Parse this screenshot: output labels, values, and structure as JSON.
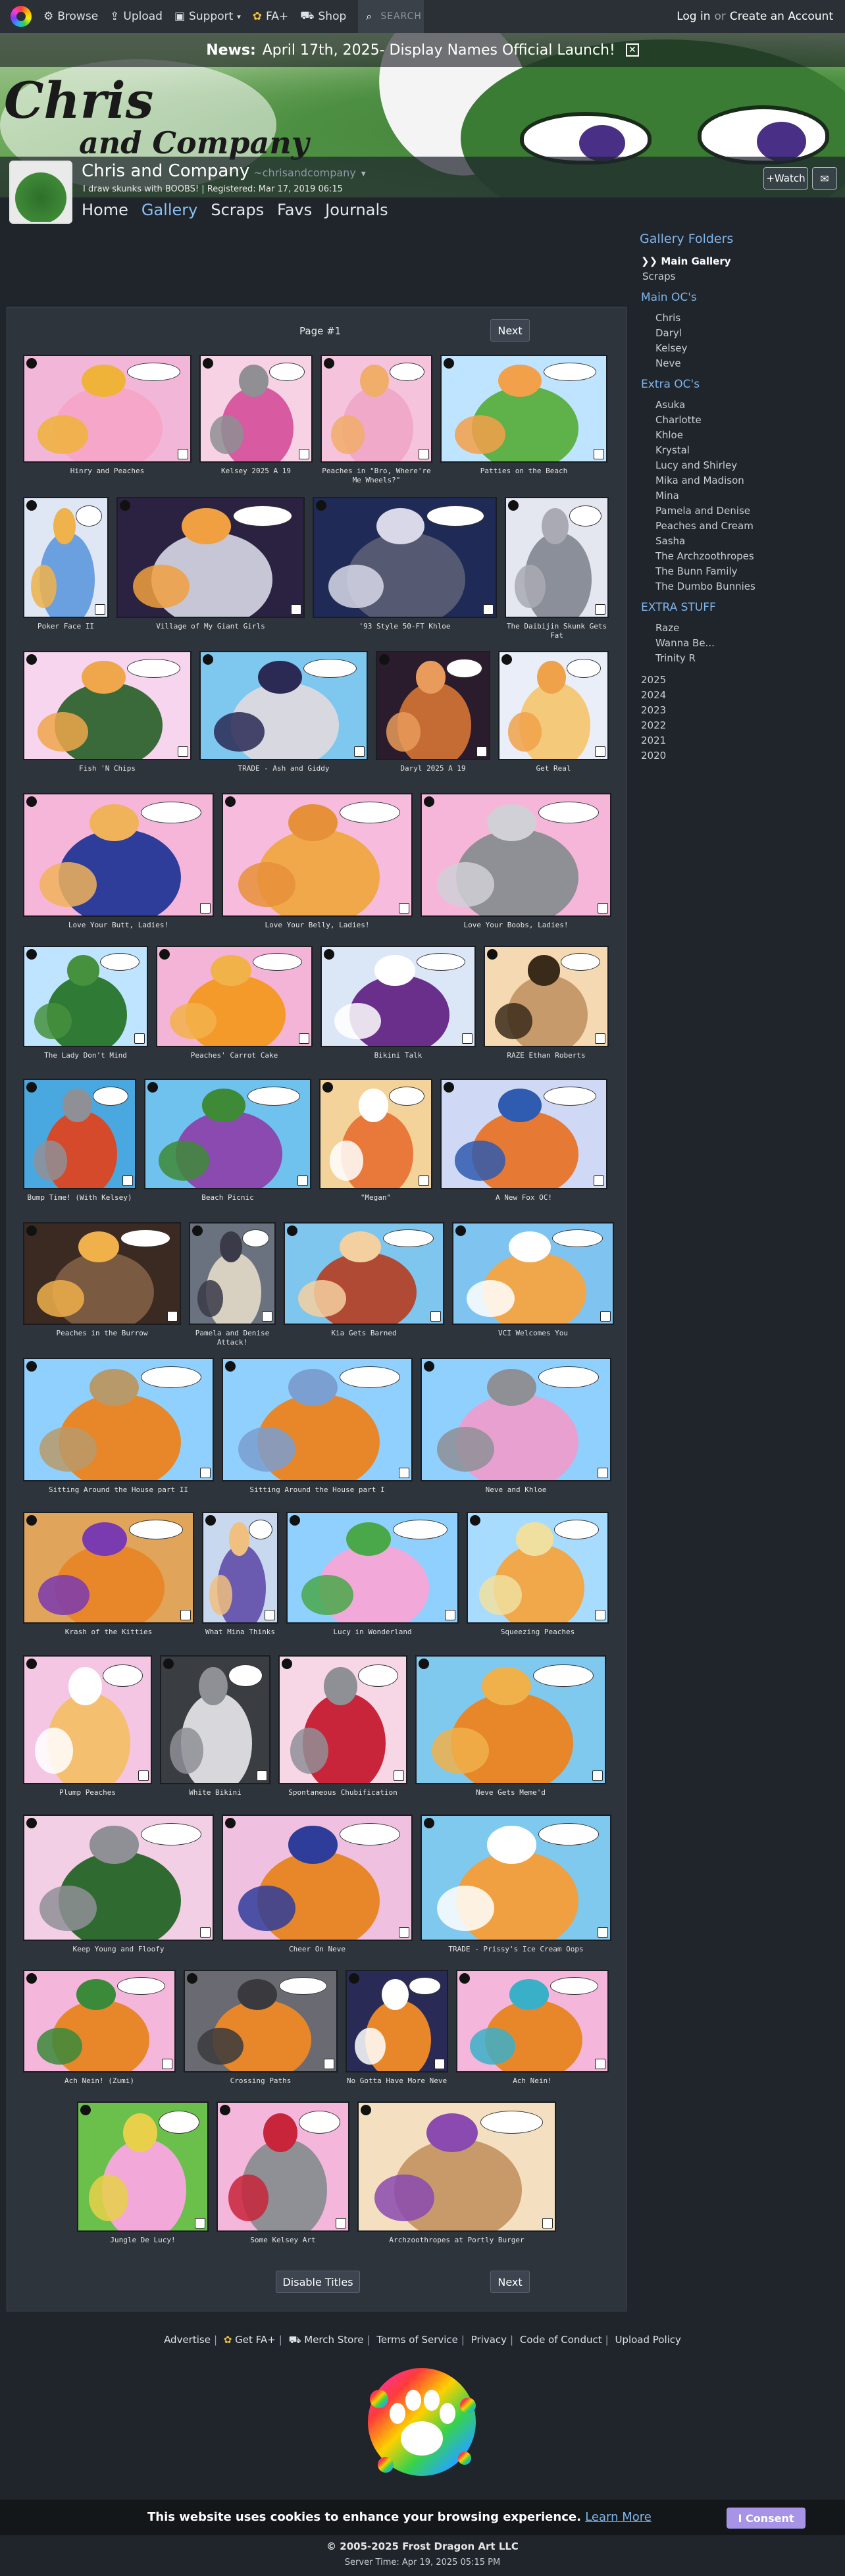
{
  "nav": {
    "browse": "Browse",
    "upload": "Upload",
    "support": "Support",
    "fa_plus": "FA+",
    "shop": "Shop",
    "search_placeholder": "SEARCH",
    "login": "Log in",
    "or": "or",
    "create": "Create an Account"
  },
  "news": {
    "label": "News:",
    "text": "April 17th, 2025- Display Names Official Launch!"
  },
  "banner": {
    "line1": "Chris",
    "line2": "and Company"
  },
  "user": {
    "display_name": "Chris and Company",
    "username": "~chrisandcompany",
    "tagline": "I draw skunks with BOOBS!",
    "registered": "Registered: Mar 17, 2019 06:15",
    "watch": "+Watch"
  },
  "tabs": [
    "Home",
    "Gallery",
    "Scraps",
    "Favs",
    "Journals"
  ],
  "sidebar": {
    "folders_title": "Gallery Folders",
    "main_gallery": "Main Gallery",
    "scraps": "Scraps",
    "main_ocs_title": "Main OC's",
    "main_ocs": [
      "Chris",
      "Daryl",
      "Kelsey",
      "Neve"
    ],
    "extra_ocs_title": "Extra OC's",
    "extra_ocs": [
      "Asuka",
      "Charlotte",
      "Khloe",
      "Krystal",
      "Lucy and Shirley",
      "Mika and Madison",
      "Mina",
      "Pamela and Denise",
      "Peaches and Cream",
      "Sasha",
      "The Archzoothropes",
      "The Bunn Family",
      "The Dumbo Bunnies"
    ],
    "extra_stuff_title": "EXTRA STUFF",
    "extra_stuff": [
      "Raze",
      "Wanna Be...",
      "Trinity R"
    ],
    "years": [
      "2025",
      "2024",
      "2023",
      "2022",
      "2021",
      "2020"
    ]
  },
  "gallery": {
    "page_label": "Page #1",
    "next": "Next",
    "disable_titles": "Disable Titles",
    "items": [
      {
        "title": "Hinry and Peaches",
        "c1": "#f2b6d8",
        "c2": "#f6a6c8",
        "c3": "#f0b33a"
      },
      {
        "title": "Kelsey 2025 A 19",
        "c1": "#f7d2e4",
        "c2": "#d85aa0",
        "c3": "#8f8f94"
      },
      {
        "title": "Peaches in \"Bro, Where're Me Wheels?\"",
        "c1": "#f6c3dc",
        "c2": "#f0a9c9",
        "c3": "#f1ad6a"
      },
      {
        "title": "Patties on the Beach",
        "c1": "#bfe4ff",
        "c2": "#5fb14a",
        "c3": "#f3a04a"
      },
      {
        "title": "Poker Face II",
        "c1": "#dfe7f5",
        "c2": "#6aa0e0",
        "c3": "#f0b24a"
      },
      {
        "title": "Village of My Giant Girls",
        "c1": "#2b2140",
        "c2": "#c6c6d6",
        "c3": "#f0a040"
      },
      {
        "title": "'93 Style 50-FT Khloe",
        "c1": "#1f2b56",
        "c2": "#555a72",
        "c3": "#d8d8e8"
      },
      {
        "title": "The Daibijin Skunk Gets Fat",
        "c1": "#e5e7f0",
        "c2": "#8b8f9a",
        "c3": "#a9aab4"
      },
      {
        "title": "Fish 'N Chips",
        "c1": "#f7d5ee",
        "c2": "#3b6a3a",
        "c3": "#f0a64a"
      },
      {
        "title": "TRADE - Ash and Giddy",
        "c1": "#7ec8f0",
        "c2": "#d8d8e0",
        "c3": "#2a2a55"
      },
      {
        "title": "Daryl 2025 A 19",
        "c1": "#2a1c2c",
        "c2": "#c56c34",
        "c3": "#e89b5a"
      },
      {
        "title": "Get Real",
        "c1": "#e9eef8",
        "c2": "#f4ca7a",
        "c3": "#f0a24a"
      },
      {
        "title": "Love Your Butt, Ladies!",
        "c1": "#f6b6da",
        "c2": "#2f3d9a",
        "c3": "#f0b35a"
      },
      {
        "title": "Love Your Belly, Ladies!",
        "c1": "#f7bbde",
        "c2": "#f0a84a",
        "c3": "#e7903a"
      },
      {
        "title": "Love Your Boobs, Ladies!",
        "c1": "#f6b6da",
        "c2": "#8f8f96",
        "c3": "#d0d0d6"
      },
      {
        "title": "The Lady Don't Mind",
        "c1": "#bfe4ff",
        "c2": "#2f7a34",
        "c3": "#45913d"
      },
      {
        "title": "Peaches' Carrot Cake",
        "c1": "#f4b4d8",
        "c2": "#f49a2a",
        "c3": "#f2b24a"
      },
      {
        "title": "Bikini Talk",
        "c1": "#dbe7f7",
        "c2": "#6a2f8a",
        "c3": "#ffffff"
      },
      {
        "title": "RAZE Ethan Roberts",
        "c1": "#f5d9b2",
        "c2": "#c69a6a",
        "c3": "#3a2a1a"
      },
      {
        "title": "Bump Time! (With Kelsey)",
        "c1": "#4aa8e0",
        "c2": "#d54a2a",
        "c3": "#8f8f96"
      },
      {
        "title": "Beach Picnic",
        "c1": "#6fc1ee",
        "c2": "#8a4ab0",
        "c3": "#3e8a37"
      },
      {
        "title": "\"Megan\"",
        "c1": "#f4d39a",
        "c2": "#e9793a",
        "c3": "#ffffff"
      },
      {
        "title": "A New Fox OC!",
        "c1": "#cfd8f4",
        "c2": "#e67a34",
        "c3": "#2f5bb0"
      },
      {
        "title": "Peaches in the Burrow",
        "c1": "#3a2a22",
        "c2": "#7a5a40",
        "c3": "#f0b04a"
      },
      {
        "title": "Pamela and Denise Attack!",
        "c1": "#6a7280",
        "c2": "#d8d0c0",
        "c3": "#3a3a48"
      },
      {
        "title": "Kia Gets Barned",
        "c1": "#7ec6ee",
        "c2": "#b04a34",
        "c3": "#f4d0a0"
      },
      {
        "title": "VCI Welcomes You",
        "c1": "#7fc4f0",
        "c2": "#f0a64a",
        "c3": "#ffffff"
      },
      {
        "title": "Sitting Around the House part II",
        "c1": "#8fd0ff",
        "c2": "#e8872a",
        "c3": "#b89a6a"
      },
      {
        "title": "Sitting Around the House part I",
        "c1": "#8fd0ff",
        "c2": "#e8872a",
        "c3": "#7a9fd0"
      },
      {
        "title": "Neve and Khloe",
        "c1": "#8fd0ff",
        "c2": "#e8a0d0",
        "c3": "#8f8f96"
      },
      {
        "title": "Krash of the Kitties",
        "c1": "#e0a45a",
        "c2": "#e8872a",
        "c3": "#7a3ab0"
      },
      {
        "title": "What Mina Thinks",
        "c1": "#c8d8ef",
        "c2": "#6a5ab0",
        "c3": "#f0c080"
      },
      {
        "title": "Lucy in Wonderland",
        "c1": "#8fd0ff",
        "c2": "#f2a8d8",
        "c3": "#4aa84a"
      },
      {
        "title": "Squeezing Peaches",
        "c1": "#a8dcff",
        "c2": "#f0a84a",
        "c3": "#f0e0a0"
      },
      {
        "title": "Plump Peaches",
        "c1": "#f4c6e4",
        "c2": "#f4c070",
        "c3": "#ffffff"
      },
      {
        "title": "White Bikini",
        "c1": "#3a3d42",
        "c2": "#d8d8dc",
        "c3": "#8f8f96"
      },
      {
        "title": "Spontaneous Chubification",
        "c1": "#f7d6e6",
        "c2": "#c8243a",
        "c3": "#8f8f96"
      },
      {
        "title": "Neve Gets Meme'd",
        "c1": "#7fc8ee",
        "c2": "#e8872a",
        "c3": "#f0b04a"
      },
      {
        "title": "Keep Young and Floofy",
        "c1": "#f2cfe4",
        "c2": "#2f6a30",
        "c3": "#8f8f96"
      },
      {
        "title": "Cheer On Neve",
        "c1": "#f0c0e0",
        "c2": "#e8872a",
        "c3": "#2f3d9a"
      },
      {
        "title": "TRADE - Prissy's Ice Cream Oops",
        "c1": "#7fc8ee",
        "c2": "#f0a040",
        "c3": "#ffffff"
      },
      {
        "title": "Ach Nein! (Zumi)",
        "c1": "#f4b6da",
        "c2": "#e8872a",
        "c3": "#3a8a3a"
      },
      {
        "title": "Crossing Paths",
        "c1": "#6a6a72",
        "c2": "#e8872a",
        "c3": "#3a3a3e"
      },
      {
        "title": "No Gotta Have More Neve",
        "c1": "#2a2a56",
        "c2": "#e8872a",
        "c3": "#ffffff"
      },
      {
        "title": "Ach Nein!",
        "c1": "#f4b6da",
        "c2": "#e8872a",
        "c3": "#3ab0c8"
      },
      {
        "title": "Jungle De Lucy!",
        "c1": "#6ac04a",
        "c2": "#f2a8d8",
        "c3": "#e8d04a"
      },
      {
        "title": "Some Kelsey Art",
        "c1": "#f4b6da",
        "c2": "#8f8f96",
        "c3": "#c8243a"
      },
      {
        "title": "Archzoothropes at Portly Burger",
        "c1": "#f4e0c0",
        "c2": "#c89a6a",
        "c3": "#8a4ab0"
      }
    ]
  },
  "footer": {
    "links": [
      "Advertise",
      "Get FA+",
      "Merch Store",
      "Terms of Service",
      "Privacy",
      "Code of Conduct",
      "Upload Policy"
    ],
    "cookie_text": "This website uses cookies to enhance your browsing experience.",
    "cookie_link": "Learn More",
    "cookie_button": "I Consent",
    "copyright": "© 2005-2025 Frost Dragon Art LLC",
    "server_time": "Server Time: Apr 19, 2025 05:15 PM"
  }
}
